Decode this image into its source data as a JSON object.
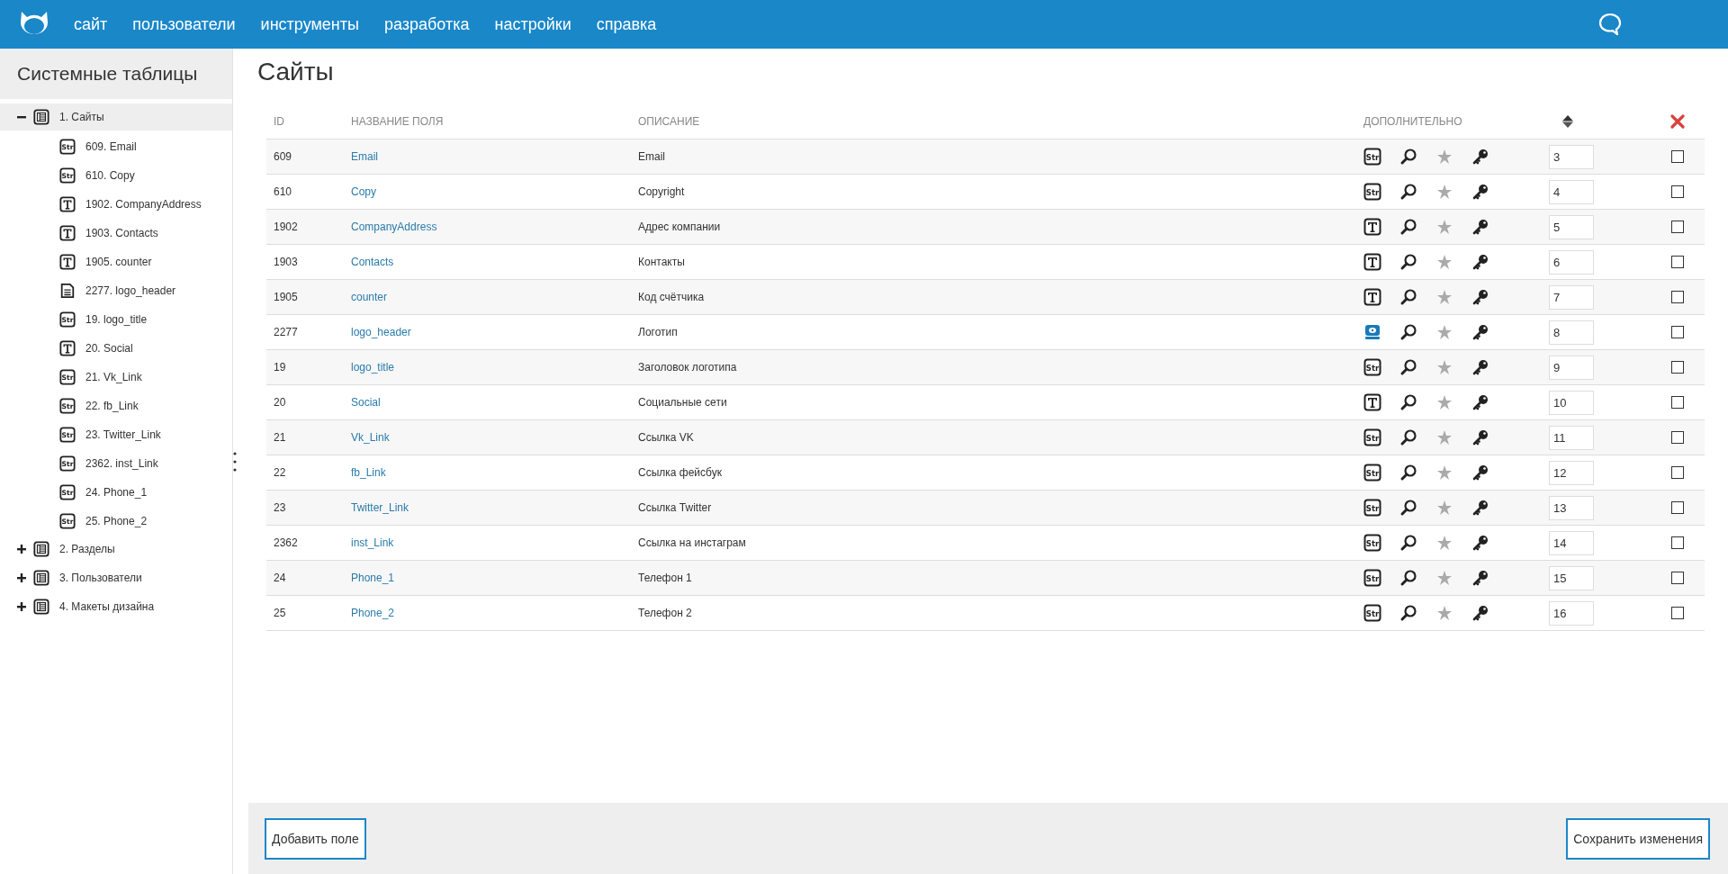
{
  "nav": {
    "items": [
      "сайт",
      "пользователи",
      "инструменты",
      "разработка",
      "настройки",
      "справка"
    ]
  },
  "sidebar": {
    "title": "Системные таблицы",
    "tree": [
      {
        "label": "1. Сайты",
        "kind": "table",
        "expanded": true,
        "selected": true,
        "children": [
          {
            "label": "609. Email",
            "kind": "str",
            "type_label": "Str"
          },
          {
            "label": "610. Copy",
            "kind": "str",
            "type_label": "Str"
          },
          {
            "label": "1902. CompanyAddress",
            "kind": "text"
          },
          {
            "label": "1903. Contacts",
            "kind": "text"
          },
          {
            "label": "1905. counter",
            "kind": "text"
          },
          {
            "label": "2277. logo_header",
            "kind": "file"
          },
          {
            "label": "19. logo_title",
            "kind": "str",
            "type_label": "Str"
          },
          {
            "label": "20. Social",
            "kind": "text"
          },
          {
            "label": "21. Vk_Link",
            "kind": "str",
            "type_label": "Str"
          },
          {
            "label": "22. fb_Link",
            "kind": "str",
            "type_label": "Str"
          },
          {
            "label": "23. Twitter_Link",
            "kind": "str",
            "type_label": "Str"
          },
          {
            "label": "2362. inst_Link",
            "kind": "str",
            "type_label": "Str"
          },
          {
            "label": "24. Phone_1",
            "kind": "str",
            "type_label": "Str"
          },
          {
            "label": "25. Phone_2",
            "kind": "str",
            "type_label": "Str"
          }
        ]
      },
      {
        "label": "2. Разделы",
        "kind": "table",
        "expanded": false,
        "selected": false
      },
      {
        "label": "3. Пользователи",
        "kind": "table",
        "expanded": false,
        "selected": false
      },
      {
        "label": "4. Макеты дизайна",
        "kind": "table",
        "expanded": false,
        "selected": false
      }
    ]
  },
  "page": {
    "title": "Сайты"
  },
  "table": {
    "columns": [
      "ID",
      "НАЗВАНИЕ ПОЛЯ",
      "ОПИСАНИЕ",
      "ДОПОЛНИТЕЛЬНО"
    ],
    "rows": [
      {
        "id": "609",
        "name": "Email",
        "description": "Email",
        "kind": "str",
        "type_label": "Str",
        "order": "3",
        "checked": false
      },
      {
        "id": "610",
        "name": "Copy",
        "description": "Copyright",
        "kind": "str",
        "type_label": "Str",
        "order": "4",
        "checked": false
      },
      {
        "id": "1902",
        "name": "CompanyAddress",
        "description": "Адрес компании",
        "kind": "text",
        "order": "5",
        "checked": false
      },
      {
        "id": "1903",
        "name": "Contacts",
        "description": "Контакты",
        "kind": "text",
        "order": "6",
        "checked": false
      },
      {
        "id": "1905",
        "name": "counter",
        "description": "Код счётчика",
        "kind": "text",
        "order": "7",
        "checked": false
      },
      {
        "id": "2277",
        "name": "logo_header",
        "description": "Логотип",
        "kind": "image",
        "order": "8",
        "checked": false
      },
      {
        "id": "19",
        "name": "logo_title",
        "description": "Заголовок логотипа",
        "kind": "str",
        "type_label": "Str",
        "order": "9",
        "checked": false
      },
      {
        "id": "20",
        "name": "Social",
        "description": "Социальные сети",
        "kind": "text",
        "order": "10",
        "checked": false
      },
      {
        "id": "21",
        "name": "Vk_Link",
        "description": "Ссылка VK",
        "kind": "str",
        "type_label": "Str",
        "order": "11",
        "checked": false
      },
      {
        "id": "22",
        "name": "fb_Link",
        "description": "Ссылка фейсбук",
        "kind": "str",
        "type_label": "Str",
        "order": "12",
        "checked": false
      },
      {
        "id": "23",
        "name": "Twitter_Link",
        "description": "Ссылка Twitter",
        "kind": "str",
        "type_label": "Str",
        "order": "13",
        "checked": false
      },
      {
        "id": "2362",
        "name": "inst_Link",
        "description": "Ссылка на инстаграм",
        "kind": "str",
        "type_label": "Str",
        "order": "14",
        "checked": false
      },
      {
        "id": "24",
        "name": "Phone_1",
        "description": "Телефон 1",
        "kind": "str",
        "type_label": "Str",
        "order": "15",
        "checked": false
      },
      {
        "id": "25",
        "name": "Phone_2",
        "description": "Телефон 2",
        "kind": "str",
        "type_label": "Str",
        "order": "16",
        "checked": false
      }
    ]
  },
  "footer": {
    "add_button": "Добавить поле",
    "save_button": "Сохранить изменения"
  }
}
